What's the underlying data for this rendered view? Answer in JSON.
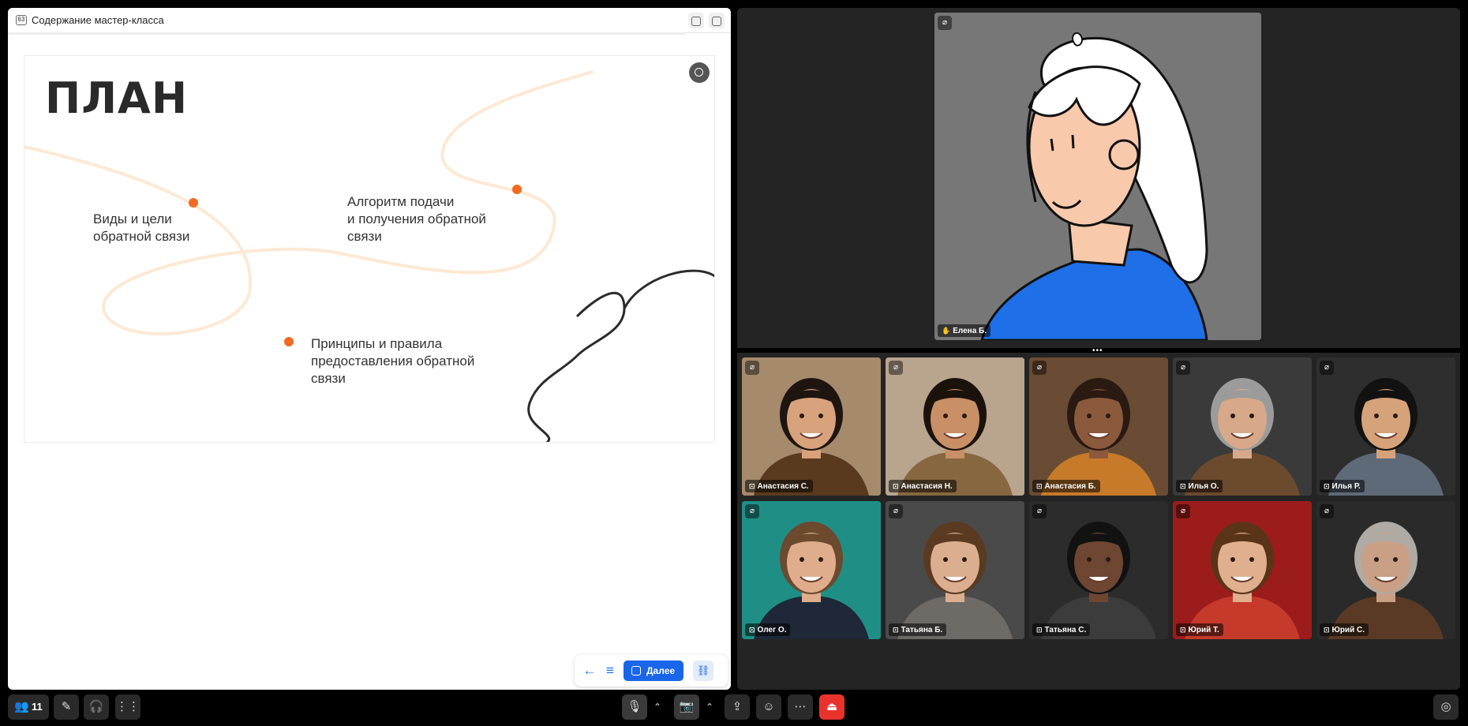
{
  "document": {
    "title": "Содержание мастер-класса",
    "icon": "document-icon"
  },
  "slide": {
    "title": "ПЛАН",
    "items": [
      {
        "label": "Виды и цели\nобратной связи"
      },
      {
        "label": "Алгоритм подачи\nи получения обратной\nсвязи"
      },
      {
        "label": "Принципы и правила\nпредоставления обратной\nсвязи"
      }
    ],
    "accent_color": "#f06a22",
    "line_color": "#fde9d4"
  },
  "slide_nav": {
    "next_label": "Далее"
  },
  "speaker": {
    "name": "Елена Б.",
    "background_color": "#777777"
  },
  "participants": [
    {
      "name": "Анастасия С.",
      "bg": "#a58a6c",
      "skin": "#d8a27c",
      "hair": "#1e1410",
      "shirt": "#5a3a1f"
    },
    {
      "name": "Анастасия Н.",
      "bg": "#b9a48e",
      "skin": "#c98f66",
      "hair": "#1b120c",
      "shirt": "#86673f"
    },
    {
      "name": "Анастасия Б.",
      "bg": "#6a4c34",
      "skin": "#8b5a3c",
      "hair": "#2a1a12",
      "shirt": "#c77a2a"
    },
    {
      "name": "Илья О.",
      "bg": "#3a3a3a",
      "skin": "#d7a98a",
      "hair": "#9b9b9b",
      "shirt": "#6c4a2d"
    },
    {
      "name": "Илья Р.",
      "bg": "#2e2e2e",
      "skin": "#d6a27a",
      "hair": "#121212",
      "shirt": "#5e6a78"
    },
    {
      "name": "Олег О.",
      "bg": "#1f8f86",
      "skin": "#e0ad8c",
      "hair": "#6b4a2e",
      "shirt": "#1e2838"
    },
    {
      "name": "Татьяна Б.",
      "bg": "#4a4a4a",
      "skin": "#dcae90",
      "hair": "#5a3b22",
      "shirt": "#6e6a66"
    },
    {
      "name": "Татьяна С.",
      "bg": "#2c2c2c",
      "skin": "#6e4632",
      "hair": "#121212",
      "shirt": "#3c3c3c"
    },
    {
      "name": "Юрий Т.",
      "bg": "#9c1c1c",
      "skin": "#e0b08e",
      "hair": "#5a3418",
      "shirt": "#c53a2a"
    },
    {
      "name": "Юрий С.",
      "bg": "#2a2a2a",
      "skin": "#c99f86",
      "hair": "#b0aaa4",
      "shirt": "#5a3a25"
    }
  ],
  "toolbar": {
    "participants_count": "11",
    "end_call_color": "#e8332c"
  }
}
